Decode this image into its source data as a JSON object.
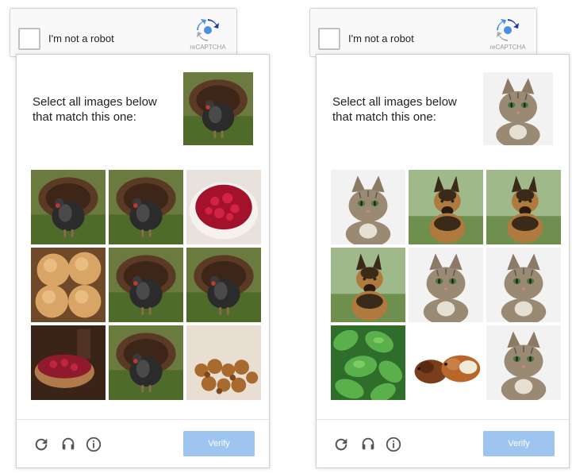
{
  "widgets": [
    {
      "checkbox_label": "I'm not a robot",
      "brand": "reCAPTCHA",
      "prompt": "Select all images below that match this one:",
      "sample_image": "turkey",
      "tiles": [
        "turkey",
        "turkey",
        "cranberry-sauce",
        "dinner-rolls",
        "turkey",
        "turkey",
        "cranberry-dish",
        "turkey",
        "stuffing"
      ],
      "footer_icons": [
        "reload-icon",
        "audio-icon",
        "info-icon"
      ],
      "verify_label": "Verify"
    },
    {
      "checkbox_label": "I'm not a robot",
      "brand": "reCAPTCHA",
      "prompt": "Select all images below that match this one:",
      "sample_image": "cat",
      "tiles": [
        "cat",
        "dog",
        "dog",
        "dog",
        "cat",
        "cat",
        "leaves",
        "guinea-pigs",
        "cat"
      ],
      "footer_icons": [
        "reload-icon",
        "audio-icon",
        "info-icon"
      ],
      "verify_label": "Verify"
    }
  ],
  "colors": {
    "verify_button": "#9ec5f0",
    "recaptcha_blue": "#4a90e2",
    "border": "#d3d3d3"
  }
}
